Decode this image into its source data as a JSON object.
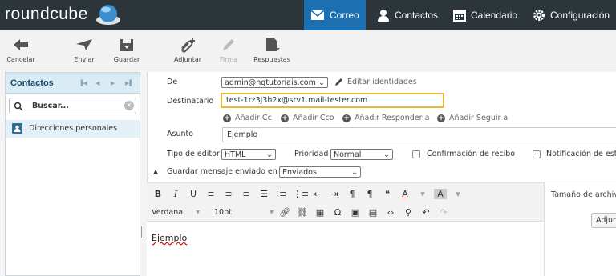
{
  "brand": {
    "name": "roundcube"
  },
  "nav": {
    "mail": "Correo",
    "contacts": "Contactos",
    "calendar": "Calendario",
    "settings": "Configuración"
  },
  "toolbar": {
    "cancel": "Cancelar",
    "send": "Enviar",
    "save": "Guardar",
    "attach": "Adjuntar",
    "signature": "Firma",
    "responses": "Respuestas"
  },
  "sidebar": {
    "title": "Contactos",
    "search_placeholder": "Buscar...",
    "items": [
      {
        "label": "Direcciones personales"
      }
    ]
  },
  "compose": {
    "from_label": "De",
    "from_value": "admin@hgtutoriais.com",
    "edit_identities": "Editar identidades",
    "to_label": "Destinatario",
    "to_value": "test-1rz3j3h2x@srv1.mail-tester.com",
    "add_cc": "Añadir Cc",
    "add_bcc": "Añadir Cco",
    "add_reply_to": "Añadir Responder a",
    "add_followup_to": "Añadir Seguir a",
    "subject_label": "Asunto",
    "subject_value": "Ejemplo",
    "editor_type_label": "Tipo de editor",
    "editor_type_value": "HTML",
    "priority_label": "Prioridad",
    "priority_value": "Normal",
    "receipt_label": "Confirmación de recibo",
    "notification_label": "Notificación de esta",
    "save_sent_label": "Guardar mensaje enviado en",
    "save_sent_value": "Enviados"
  },
  "editor": {
    "font": "Verdana",
    "size": "10pt",
    "body": "Ejemplo"
  },
  "attachments": {
    "title": "Tamaño de archiv",
    "button": "Adjun"
  },
  "colors": {
    "topbar": "#2c363a",
    "active_nav": "#1c6fb0",
    "highlight": "#e8b932"
  }
}
